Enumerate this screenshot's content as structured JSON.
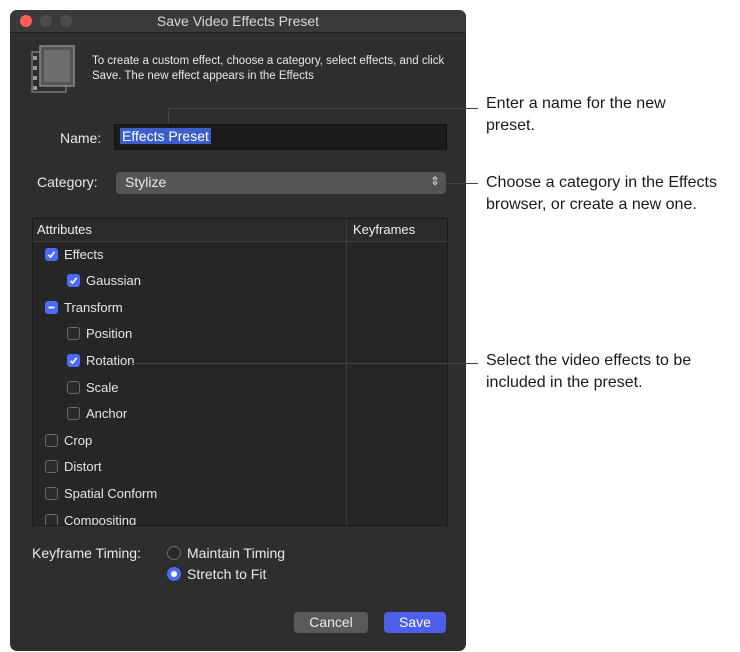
{
  "dialog": {
    "title": "Save Video Effects Preset",
    "intro": "To create a custom effect, choose a category, select effects, and click Save. The new effect appears in the Effects",
    "name_label": "Name:",
    "name_value": "Effects Preset",
    "category_label": "Category:",
    "category_value": "Stylize",
    "table": {
      "col_attributes": "Attributes",
      "col_keyframes": "Keyframes",
      "rows": [
        {
          "label": "Effects",
          "state": "on",
          "indent": 0
        },
        {
          "label": "Gaussian",
          "state": "on",
          "indent": 1
        },
        {
          "label": "Transform",
          "state": "mixed",
          "indent": 0
        },
        {
          "label": "Position",
          "state": "off",
          "indent": 1
        },
        {
          "label": "Rotation",
          "state": "on",
          "indent": 1
        },
        {
          "label": "Scale",
          "state": "off",
          "indent": 1
        },
        {
          "label": "Anchor",
          "state": "off",
          "indent": 1
        },
        {
          "label": "Crop",
          "state": "off",
          "indent": 0
        },
        {
          "label": "Distort",
          "state": "off",
          "indent": 0
        },
        {
          "label": "Spatial Conform",
          "state": "off",
          "indent": 0
        },
        {
          "label": "Compositing",
          "state": "off",
          "indent": 0
        }
      ]
    },
    "keyframe_timing_label": "Keyframe Timing:",
    "timing_options": [
      {
        "label": "Maintain Timing",
        "selected": false
      },
      {
        "label": "Stretch to Fit",
        "selected": true
      }
    ],
    "cancel_label": "Cancel",
    "save_label": "Save",
    "accent_color": "#4d6cf5"
  },
  "callouts": {
    "name": "Enter a name for the new preset.",
    "category": "Choose a category in the Effects browser, or create a new one.",
    "effects": "Select the video effects to be included in the preset."
  }
}
